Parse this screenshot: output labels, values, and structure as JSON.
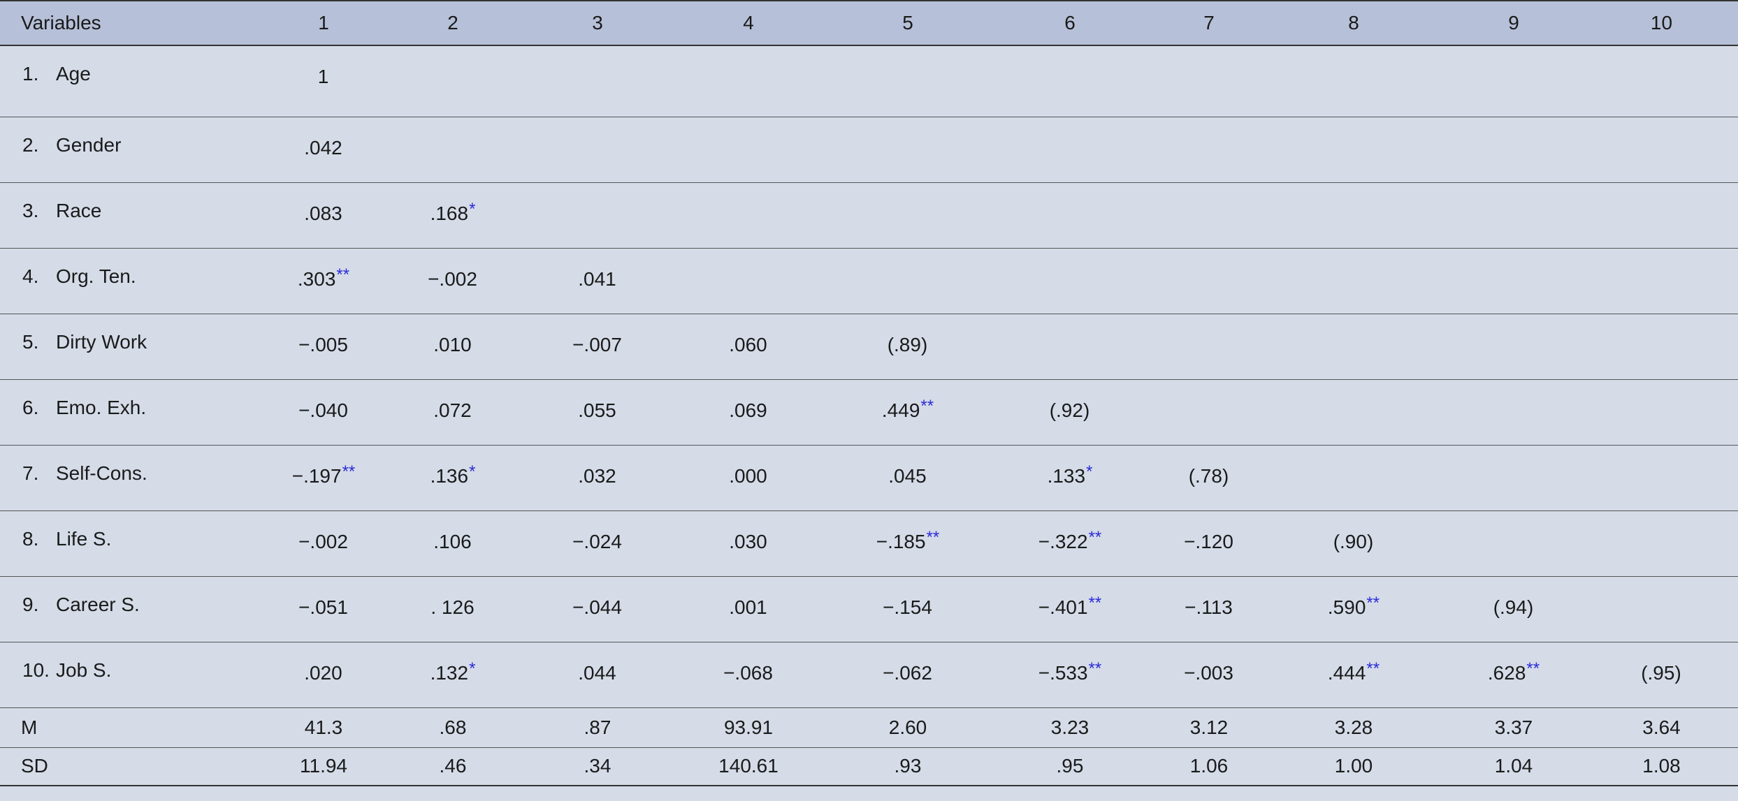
{
  "table": {
    "header": [
      "Variables",
      "1",
      "2",
      "3",
      "4",
      "5",
      "6",
      "7",
      "8",
      "9",
      "10"
    ],
    "rows": [
      {
        "num": "1.",
        "label": "Age",
        "cells": [
          [
            "1",
            ""
          ],
          [
            "",
            ""
          ],
          [
            "",
            ""
          ],
          [
            "",
            ""
          ],
          [
            "",
            ""
          ],
          [
            "",
            ""
          ],
          [
            "",
            ""
          ],
          [
            "",
            ""
          ],
          [
            "",
            ""
          ],
          [
            "",
            ""
          ]
        ]
      },
      {
        "num": "2.",
        "label": "Gender",
        "cells": [
          [
            ".042",
            ""
          ],
          [
            "",
            ""
          ],
          [
            "",
            ""
          ],
          [
            "",
            ""
          ],
          [
            "",
            ""
          ],
          [
            "",
            ""
          ],
          [
            "",
            ""
          ],
          [
            "",
            ""
          ],
          [
            "",
            ""
          ],
          [
            "",
            ""
          ]
        ]
      },
      {
        "num": "3.",
        "label": "Race",
        "cells": [
          [
            ".083",
            ""
          ],
          [
            ".168",
            "*"
          ],
          [
            "",
            ""
          ],
          [
            "",
            ""
          ],
          [
            "",
            ""
          ],
          [
            "",
            ""
          ],
          [
            "",
            ""
          ],
          [
            "",
            ""
          ],
          [
            "",
            ""
          ],
          [
            "",
            ""
          ]
        ]
      },
      {
        "num": "4.",
        "label": "Org. Ten.",
        "cells": [
          [
            ".303",
            "**"
          ],
          [
            "−.002",
            ""
          ],
          [
            ".041",
            ""
          ],
          [
            "",
            ""
          ],
          [
            "",
            ""
          ],
          [
            "",
            ""
          ],
          [
            "",
            ""
          ],
          [
            "",
            ""
          ],
          [
            "",
            ""
          ],
          [
            "",
            ""
          ]
        ]
      },
      {
        "num": "5.",
        "label": "Dirty Work",
        "cells": [
          [
            "−.005",
            ""
          ],
          [
            ".010",
            ""
          ],
          [
            "−.007",
            ""
          ],
          [
            ".060",
            ""
          ],
          [
            "(.89)",
            ""
          ],
          [
            "",
            ""
          ],
          [
            "",
            ""
          ],
          [
            "",
            ""
          ],
          [
            "",
            ""
          ],
          [
            "",
            ""
          ]
        ]
      },
      {
        "num": "6.",
        "label": "Emo. Exh.",
        "cells": [
          [
            "−.040",
            ""
          ],
          [
            ".072",
            ""
          ],
          [
            ".055",
            ""
          ],
          [
            ".069",
            ""
          ],
          [
            ".449",
            "**"
          ],
          [
            "(.92)",
            ""
          ],
          [
            "",
            ""
          ],
          [
            "",
            ""
          ],
          [
            "",
            ""
          ],
          [
            "",
            ""
          ]
        ]
      },
      {
        "num": "7.",
        "label": "Self-Cons.",
        "cells": [
          [
            "−.197",
            "**"
          ],
          [
            ".136",
            "*"
          ],
          [
            ".032",
            ""
          ],
          [
            ".000",
            ""
          ],
          [
            ".045",
            ""
          ],
          [
            ".133",
            "*"
          ],
          [
            "(.78)",
            ""
          ],
          [
            "",
            ""
          ],
          [
            "",
            ""
          ],
          [
            "",
            ""
          ]
        ]
      },
      {
        "num": "8.",
        "label": "Life S.",
        "cells": [
          [
            "−.002",
            ""
          ],
          [
            ".106",
            ""
          ],
          [
            "−.024",
            ""
          ],
          [
            ".030",
            ""
          ],
          [
            "−.185",
            "**"
          ],
          [
            "−.322",
            "**"
          ],
          [
            "−.120",
            ""
          ],
          [
            "(.90)",
            ""
          ],
          [
            "",
            ""
          ],
          [
            "",
            ""
          ]
        ]
      },
      {
        "num": "9.",
        "label": "Career S.",
        "cells": [
          [
            "−.051",
            ""
          ],
          [
            ". 126",
            ""
          ],
          [
            "−.044",
            ""
          ],
          [
            ".001",
            ""
          ],
          [
            "−.154",
            ""
          ],
          [
            "−.401",
            "**"
          ],
          [
            "−.113",
            ""
          ],
          [
            ".590",
            "**"
          ],
          [
            "(.94)",
            ""
          ],
          [
            "",
            ""
          ]
        ]
      },
      {
        "num": "10.",
        "label": "Job S.",
        "cells": [
          [
            ".020",
            ""
          ],
          [
            ".132",
            "*"
          ],
          [
            ".044",
            ""
          ],
          [
            "−.068",
            ""
          ],
          [
            "−.062",
            ""
          ],
          [
            "−.533",
            "**"
          ],
          [
            "−.003",
            ""
          ],
          [
            ".444",
            "**"
          ],
          [
            ".628",
            "**"
          ],
          [
            "(.95)",
            ""
          ]
        ]
      }
    ],
    "summary": [
      {
        "label": "M",
        "values": [
          "41.3",
          ".68",
          ".87",
          "93.91",
          "2.60",
          "3.23",
          "3.12",
          "3.28",
          "3.37",
          "3.64"
        ]
      },
      {
        "label": "SD",
        "values": [
          "11.94",
          ".46",
          ".34",
          "140.61",
          ".93",
          ".95",
          "1.06",
          "1.00",
          "1.04",
          "1.08"
        ]
      }
    ]
  },
  "colors": {
    "header_bg": "#b6c0d8",
    "body_bg": "#d5dce8",
    "significance_mark": "#2b2bd6"
  }
}
